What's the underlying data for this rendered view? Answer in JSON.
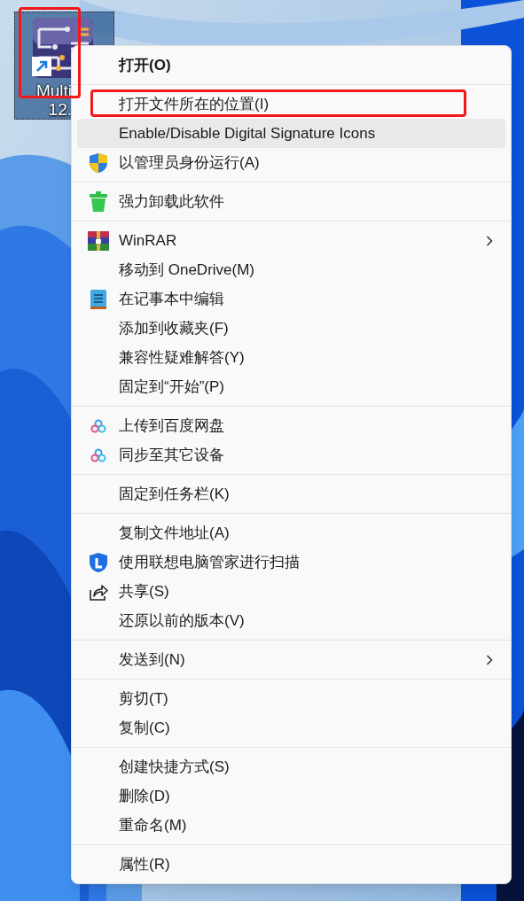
{
  "desktop_icon": {
    "label_lines": [
      "Multi",
      "12."
    ],
    "selected": true,
    "highlighted": true
  },
  "menu": {
    "sections": [
      {
        "items": [
          {
            "label": "打开(O)",
            "default": true
          }
        ]
      },
      {
        "items": [
          {
            "label": "打开文件所在的位置(I)",
            "highlighted": true
          },
          {
            "label": "Enable/Disable Digital Signature Icons",
            "hovered": true
          },
          {
            "label": "以管理员身份运行(A)"
          }
        ]
      },
      {
        "items": [
          {
            "label": "强力卸载此软件"
          }
        ]
      },
      {
        "items": [
          {
            "label": "WinRAR",
            "submenu": true
          },
          {
            "label": "移动到 OneDrive(M)"
          },
          {
            "label": "在记事本中编辑"
          },
          {
            "label": "添加到收藏夹(F)"
          },
          {
            "label": "兼容性疑难解答(Y)"
          },
          {
            "label": "固定到“开始”(P)"
          }
        ]
      },
      {
        "items": [
          {
            "label": "上传到百度网盘"
          },
          {
            "label": "同步至其它设备"
          }
        ]
      },
      {
        "items": [
          {
            "label": "固定到任务栏(K)"
          }
        ]
      },
      {
        "items": [
          {
            "label": "复制文件地址(A)"
          },
          {
            "label": "使用联想电脑管家进行扫描"
          },
          {
            "label": "共享(S)"
          },
          {
            "label": "还原以前的版本(V)"
          }
        ]
      },
      {
        "items": [
          {
            "label": "发送到(N)",
            "submenu": true
          }
        ]
      },
      {
        "items": [
          {
            "label": "剪切(T)"
          },
          {
            "label": "复制(C)"
          }
        ]
      },
      {
        "items": [
          {
            "label": "创建快捷方式(S)"
          },
          {
            "label": "删除(D)"
          },
          {
            "label": "重命名(M)"
          }
        ]
      },
      {
        "items": [
          {
            "label": "属性(R)"
          }
        ]
      }
    ]
  }
}
